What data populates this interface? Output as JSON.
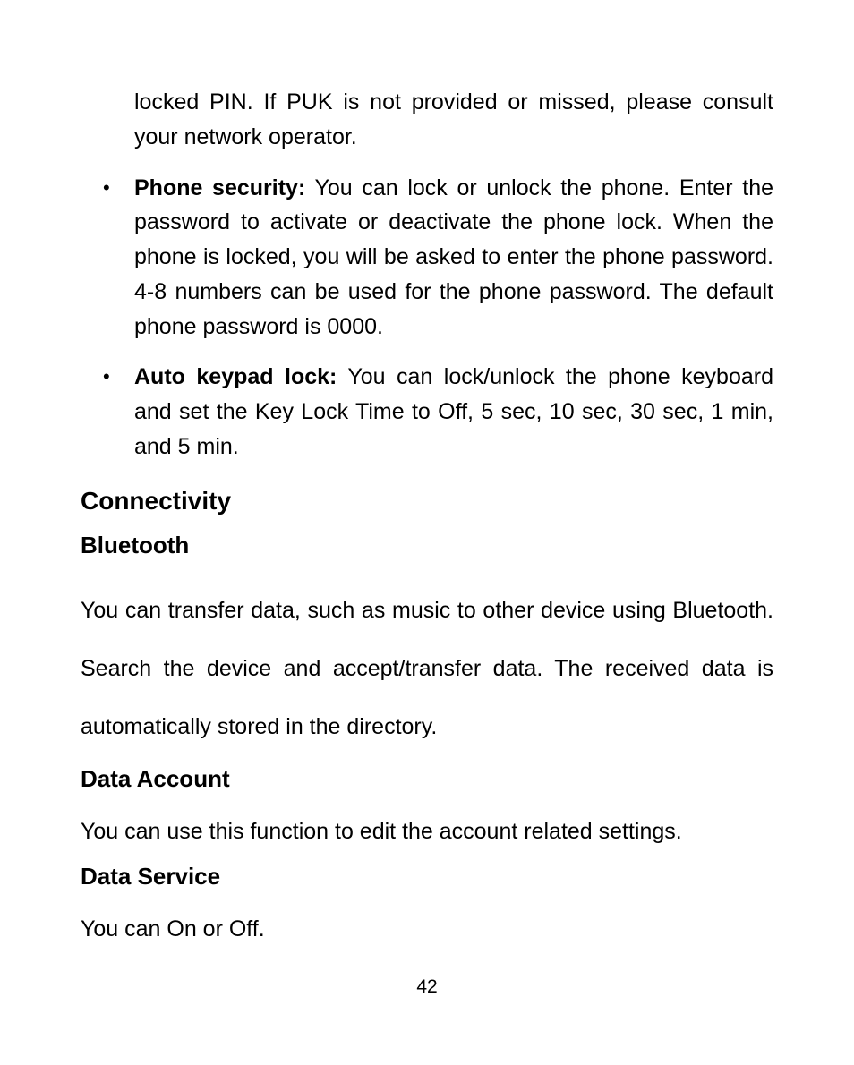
{
  "continuation": "locked PIN. If PUK is not provided or missed, please consult your network operator.",
  "bullets": [
    {
      "title": "Phone security:",
      "text": " You can lock or unlock the phone. Enter the password to activate or deactivate the phone lock. When the phone is locked, you will be asked to enter the phone password. 4-8 numbers can be used for the phone password. The default phone password is 0000."
    },
    {
      "title": "Auto keypad lock:",
      "text": " You can lock/unlock the phone keyboard and set the Key Lock Time to Off, 5 sec, 10 sec, 30 sec, 1 min, and 5 min."
    }
  ],
  "sections": {
    "connectivity": {
      "heading": "Connectivity",
      "bluetooth": {
        "heading": "Bluetooth",
        "text": "You can transfer data, such as music to other device using Bluetooth. Search the device and accept/transfer data. The received data is automatically stored in the directory."
      },
      "data_account": {
        "heading": "Data Account",
        "text": "You can use this function to edit the account related settings."
      },
      "data_service": {
        "heading": "Data Service",
        "text": "You can On or Off."
      }
    }
  },
  "page_number": "42"
}
